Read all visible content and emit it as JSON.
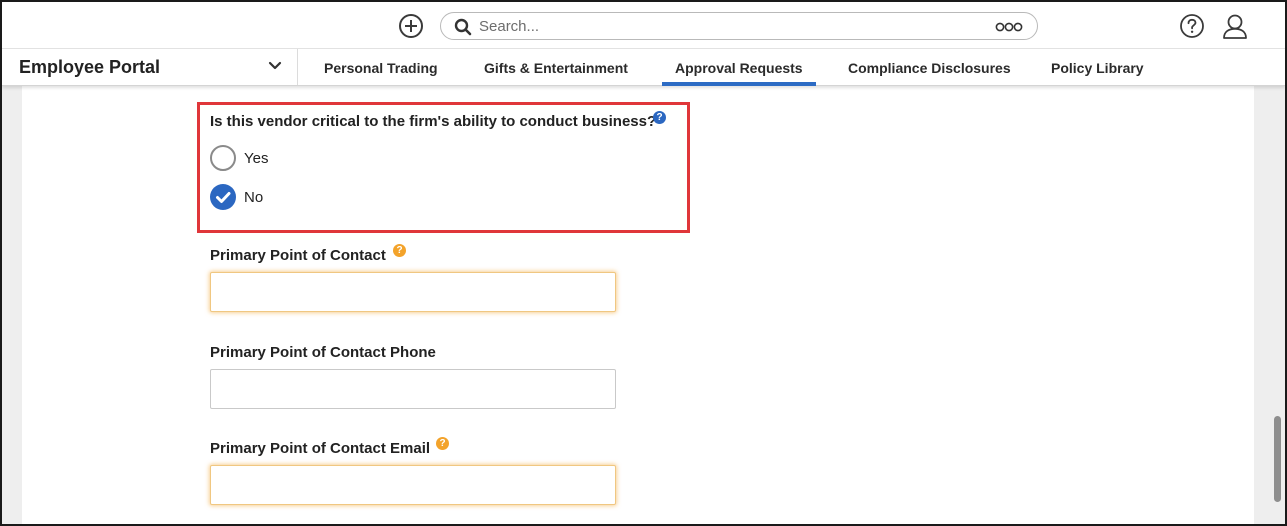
{
  "search": {
    "placeholder": "Search..."
  },
  "portal": {
    "title": "Employee Portal"
  },
  "nav": {
    "tabs": [
      {
        "label": "Personal Trading"
      },
      {
        "label": "Gifts & Entertainment"
      },
      {
        "label": "Approval Requests",
        "active": true
      },
      {
        "label": "Compliance Disclosures"
      },
      {
        "label": "Policy Library"
      }
    ]
  },
  "question": {
    "label": "Is this vendor critical to the firm's ability to conduct business?",
    "help_glyph": "?",
    "options": [
      {
        "label": "Yes",
        "selected": false
      },
      {
        "label": "No",
        "selected": true
      }
    ]
  },
  "fields": {
    "contact": {
      "label": "Primary Point of Contact",
      "value": "",
      "required_glyph": "?"
    },
    "phone": {
      "label": "Primary Point of Contact Phone",
      "value": ""
    },
    "email": {
      "label": "Primary Point of Contact Email",
      "value": "",
      "required_glyph": "?"
    }
  },
  "colors": {
    "accent": "#2c6bc4",
    "highlight_border": "#e0363a",
    "required_icon": "#f3a32b",
    "page_bg": "#eeeeee"
  },
  "icons": [
    "plus-circle-icon",
    "search-icon",
    "more-options-icon",
    "help-icon",
    "user-icon",
    "chevron-down-icon",
    "checkmark-icon"
  ]
}
